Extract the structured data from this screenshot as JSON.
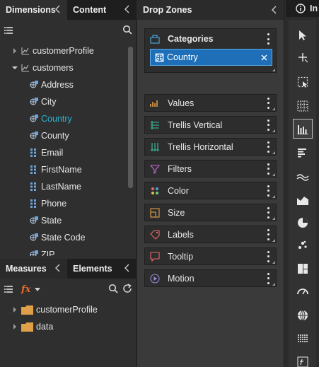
{
  "left_tabs": {
    "dimensions": "Dimensions",
    "content": "Content"
  },
  "tree": [
    {
      "label": "customerProfile",
      "expanded": false
    },
    {
      "label": "customers",
      "expanded": true
    }
  ],
  "fields": [
    {
      "label": "Address",
      "type": "geo"
    },
    {
      "label": "City",
      "type": "geo"
    },
    {
      "label": "Country",
      "type": "geo",
      "selected": true
    },
    {
      "label": "County",
      "type": "geo"
    },
    {
      "label": "Email",
      "type": "text"
    },
    {
      "label": "FirstName",
      "type": "text"
    },
    {
      "label": "LastName",
      "type": "text"
    },
    {
      "label": "Phone",
      "type": "text"
    },
    {
      "label": "State",
      "type": "geo"
    },
    {
      "label": "State Code",
      "type": "geo"
    },
    {
      "label": "ZIP",
      "type": "geo"
    }
  ],
  "bottom_tabs": {
    "measures": "Measures",
    "elements": "Elements"
  },
  "bottom_tree": [
    {
      "label": "customerProfile"
    },
    {
      "label": "data"
    }
  ],
  "dropzones": {
    "title": "Drop Zones",
    "categories": {
      "label": "Categories",
      "chip": "Country"
    },
    "zones": [
      {
        "label": "Values",
        "icon": "values-icon"
      },
      {
        "label": "Trellis Vertical",
        "icon": "trellis-vertical-icon"
      },
      {
        "label": "Trellis Horizontal",
        "icon": "trellis-horizontal-icon"
      },
      {
        "label": "Filters",
        "icon": "filter-icon"
      },
      {
        "label": "Color",
        "icon": "color-icon"
      },
      {
        "label": "Size",
        "icon": "size-icon"
      },
      {
        "label": "Labels",
        "icon": "labels-icon"
      },
      {
        "label": "Tooltip",
        "icon": "tooltip-icon"
      },
      {
        "label": "Motion",
        "icon": "motion-icon"
      }
    ]
  },
  "rail": {
    "top_label": "In",
    "tools": [
      "pointer-icon",
      "crosshair-icon",
      "selection-icon",
      "grid-icon",
      "column-chart-icon",
      "bar-chart-icon",
      "line-chart-icon",
      "area-chart-icon",
      "pie-chart-icon",
      "scatter-icon",
      "treemap-icon",
      "gauge-icon",
      "map-icon",
      "table-icon",
      "formula-icon"
    ],
    "active_tool": "column-chart-icon"
  },
  "colors": {
    "accent": "#29b6d6",
    "chip": "#1f6fb8",
    "folder": "#e0a04a",
    "field_icon": "#6fa3d9"
  }
}
